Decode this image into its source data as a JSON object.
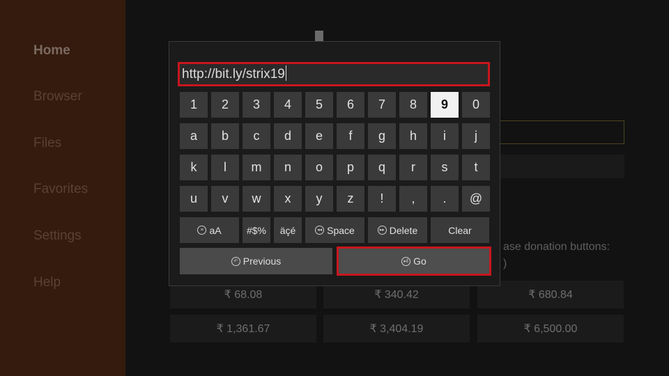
{
  "sidebar": {
    "items": [
      {
        "label": "Home"
      },
      {
        "label": "Browser"
      },
      {
        "label": "Files"
      },
      {
        "label": "Favorites"
      },
      {
        "label": "Settings"
      },
      {
        "label": "Help"
      }
    ]
  },
  "background": {
    "donation_label": "ase donation buttons:",
    "donation_label_2": ")",
    "donations": [
      {
        "label": "₹ 68.08"
      },
      {
        "label": "₹ 340.42"
      },
      {
        "label": "₹ 680.84"
      },
      {
        "label": "₹ 1,361.67"
      },
      {
        "label": "₹ 3,404.19"
      },
      {
        "label": "₹ 6,500.00"
      }
    ]
  },
  "keyboard": {
    "url_value": "http://bit.ly/strix19",
    "selected_key": "9",
    "rows": [
      [
        "1",
        "2",
        "3",
        "4",
        "5",
        "6",
        "7",
        "8",
        "9",
        "0"
      ],
      [
        "a",
        "b",
        "c",
        "d",
        "e",
        "f",
        "g",
        "h",
        "i",
        "j"
      ],
      [
        "k",
        "l",
        "m",
        "n",
        "o",
        "p",
        "q",
        "r",
        "s",
        "t"
      ],
      [
        "u",
        "v",
        "w",
        "x",
        "y",
        "z",
        "!",
        ",",
        ".",
        "@"
      ]
    ],
    "func_keys": {
      "case_label_a": "aA",
      "symbols_label": "#$%",
      "accents_label": "äçé",
      "space_label": "Space",
      "delete_label": "Delete",
      "clear_label": "Clear"
    },
    "previous_label": "Previous",
    "go_label": "Go"
  }
}
